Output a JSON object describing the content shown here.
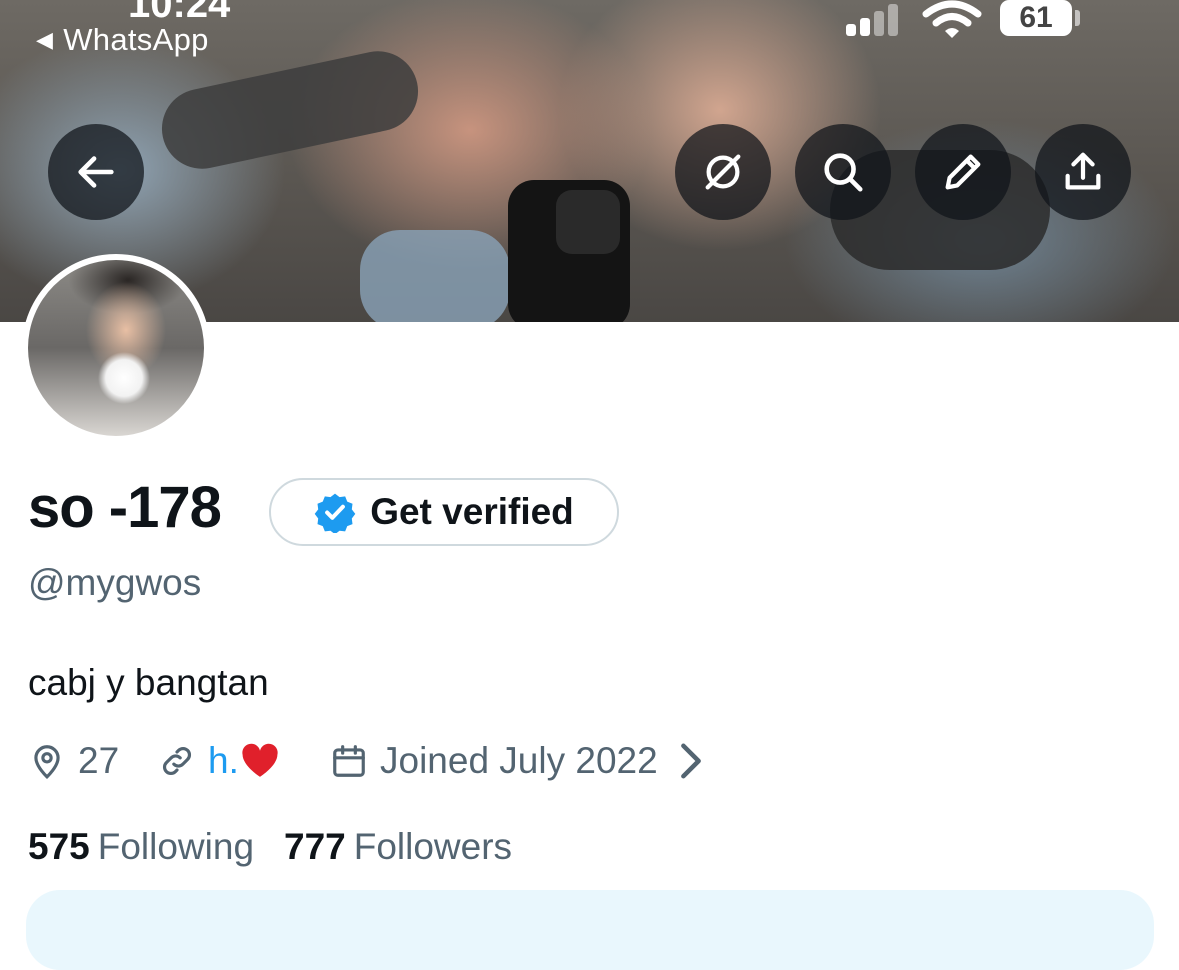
{
  "status_bar": {
    "back_app": "WhatsApp",
    "time": "10:24",
    "battery": "61"
  },
  "header": {
    "buttons": [
      "back-arrow-icon",
      "grok-icon",
      "search-icon",
      "edit-icon",
      "share-icon"
    ]
  },
  "profile": {
    "display_name": "so -178",
    "verify_label": "Get verified",
    "handle": "@mygwos",
    "bio": "cabj y bangtan",
    "location": "27",
    "link": "h.",
    "joined": "Joined July 2022",
    "following_count": "575",
    "following_label": "Following",
    "followers_count": "777",
    "followers_label": "Followers"
  },
  "colors": {
    "accent": "#1d9bf0",
    "secondary_text": "#536471",
    "primary_text": "#0f1419",
    "heart": "#e0202b",
    "promo_bg": "#e9f7fd"
  }
}
